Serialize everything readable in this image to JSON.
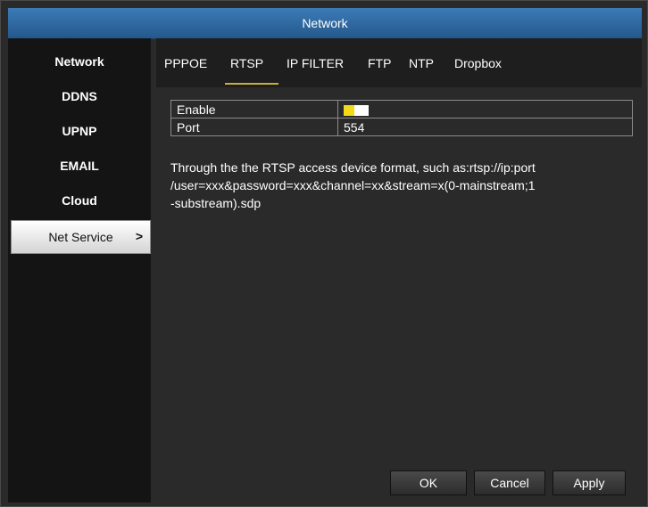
{
  "window": {
    "title": "Network"
  },
  "sidebar": {
    "items": [
      {
        "label": "Network"
      },
      {
        "label": "DDNS"
      },
      {
        "label": "UPNP"
      },
      {
        "label": "EMAIL"
      },
      {
        "label": "Cloud"
      },
      {
        "label": "Net Service",
        "active": true,
        "arrow": ">"
      }
    ]
  },
  "tabs": [
    {
      "label": "PPPOE"
    },
    {
      "label": "RTSP",
      "active": true
    },
    {
      "label": "IP FILTER"
    },
    {
      "label": "FTP"
    },
    {
      "label": "NTP"
    },
    {
      "label": "Dropbox"
    }
  ],
  "settings": {
    "enable": {
      "label": "Enable",
      "value": true
    },
    "port": {
      "label": "Port",
      "value": "554"
    }
  },
  "description": {
    "line1": "Through the the RTSP access device format, such as:rtsp://ip:port",
    "line2": "/user=xxx&password=xxx&channel=xx&stream=x(0-mainstream;1",
    "line3": "-substream).sdp"
  },
  "buttons": {
    "ok": "OK",
    "cancel": "Cancel",
    "apply": "Apply"
  },
  "colors": {
    "title_bar": "#2f6aa3",
    "accent_underline": "#c8b038",
    "toggle_knob": "#f2d91a",
    "panel": "#2a2a2a",
    "sidebar": "#141414"
  }
}
